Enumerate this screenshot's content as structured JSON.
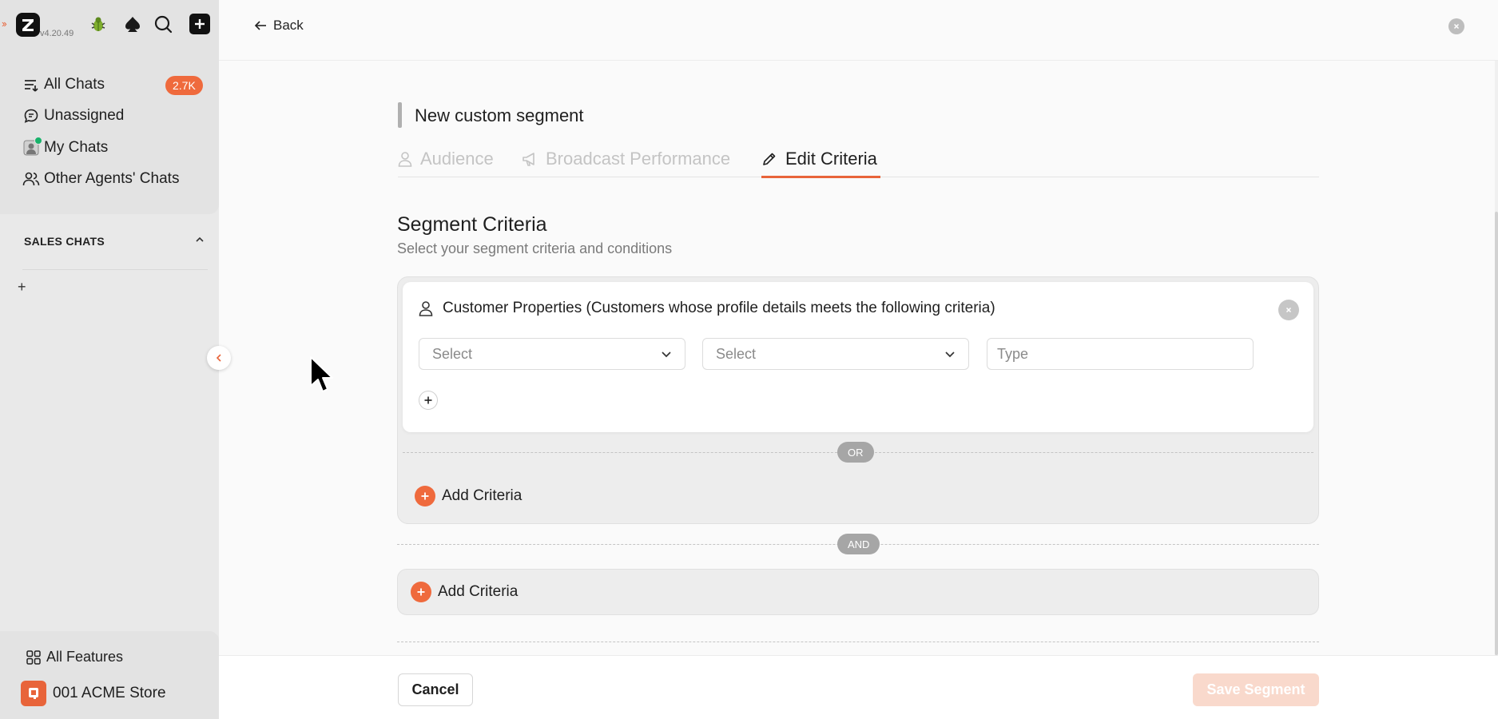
{
  "app": {
    "version": "v4.20.49",
    "accent_color": "#e8643a"
  },
  "sidebar": {
    "nav": [
      {
        "label": "All Chats",
        "icon": "list-filter-icon",
        "badge": "2.7K"
      },
      {
        "label": "Unassigned",
        "icon": "chat-bubble-icon"
      },
      {
        "label": "My Chats",
        "icon": "agent-avatar-icon",
        "online": true
      },
      {
        "label": "Other Agents' Chats",
        "icon": "users-icon"
      }
    ],
    "section_title": "SALES CHATS",
    "bottom": {
      "all_features_label": "All Features",
      "store_name": "001 ACME Store"
    }
  },
  "header": {
    "back_label": "Back"
  },
  "segment": {
    "title": "New custom segment",
    "tabs": [
      {
        "label": "Audience",
        "icon": "user-icon",
        "active": false
      },
      {
        "label": "Broadcast Performance",
        "icon": "megaphone-icon",
        "active": false
      },
      {
        "label": "Edit Criteria",
        "icon": "pencil-icon",
        "active": true
      }
    ],
    "criteria_title": "Segment Criteria",
    "criteria_subtitle": "Select your segment criteria and conditions",
    "condition_card": {
      "title": "Customer Properties (Customers whose profile details meets the following criteria)",
      "select1_placeholder": "Select",
      "select2_placeholder": "Select",
      "type_placeholder": "Type"
    },
    "or_label": "OR",
    "and_label": "AND",
    "add_criteria_or_label": "Add Criteria",
    "add_criteria_and_label": "Add Criteria"
  },
  "footer": {
    "cancel_label": "Cancel",
    "save_label": "Save Segment"
  }
}
